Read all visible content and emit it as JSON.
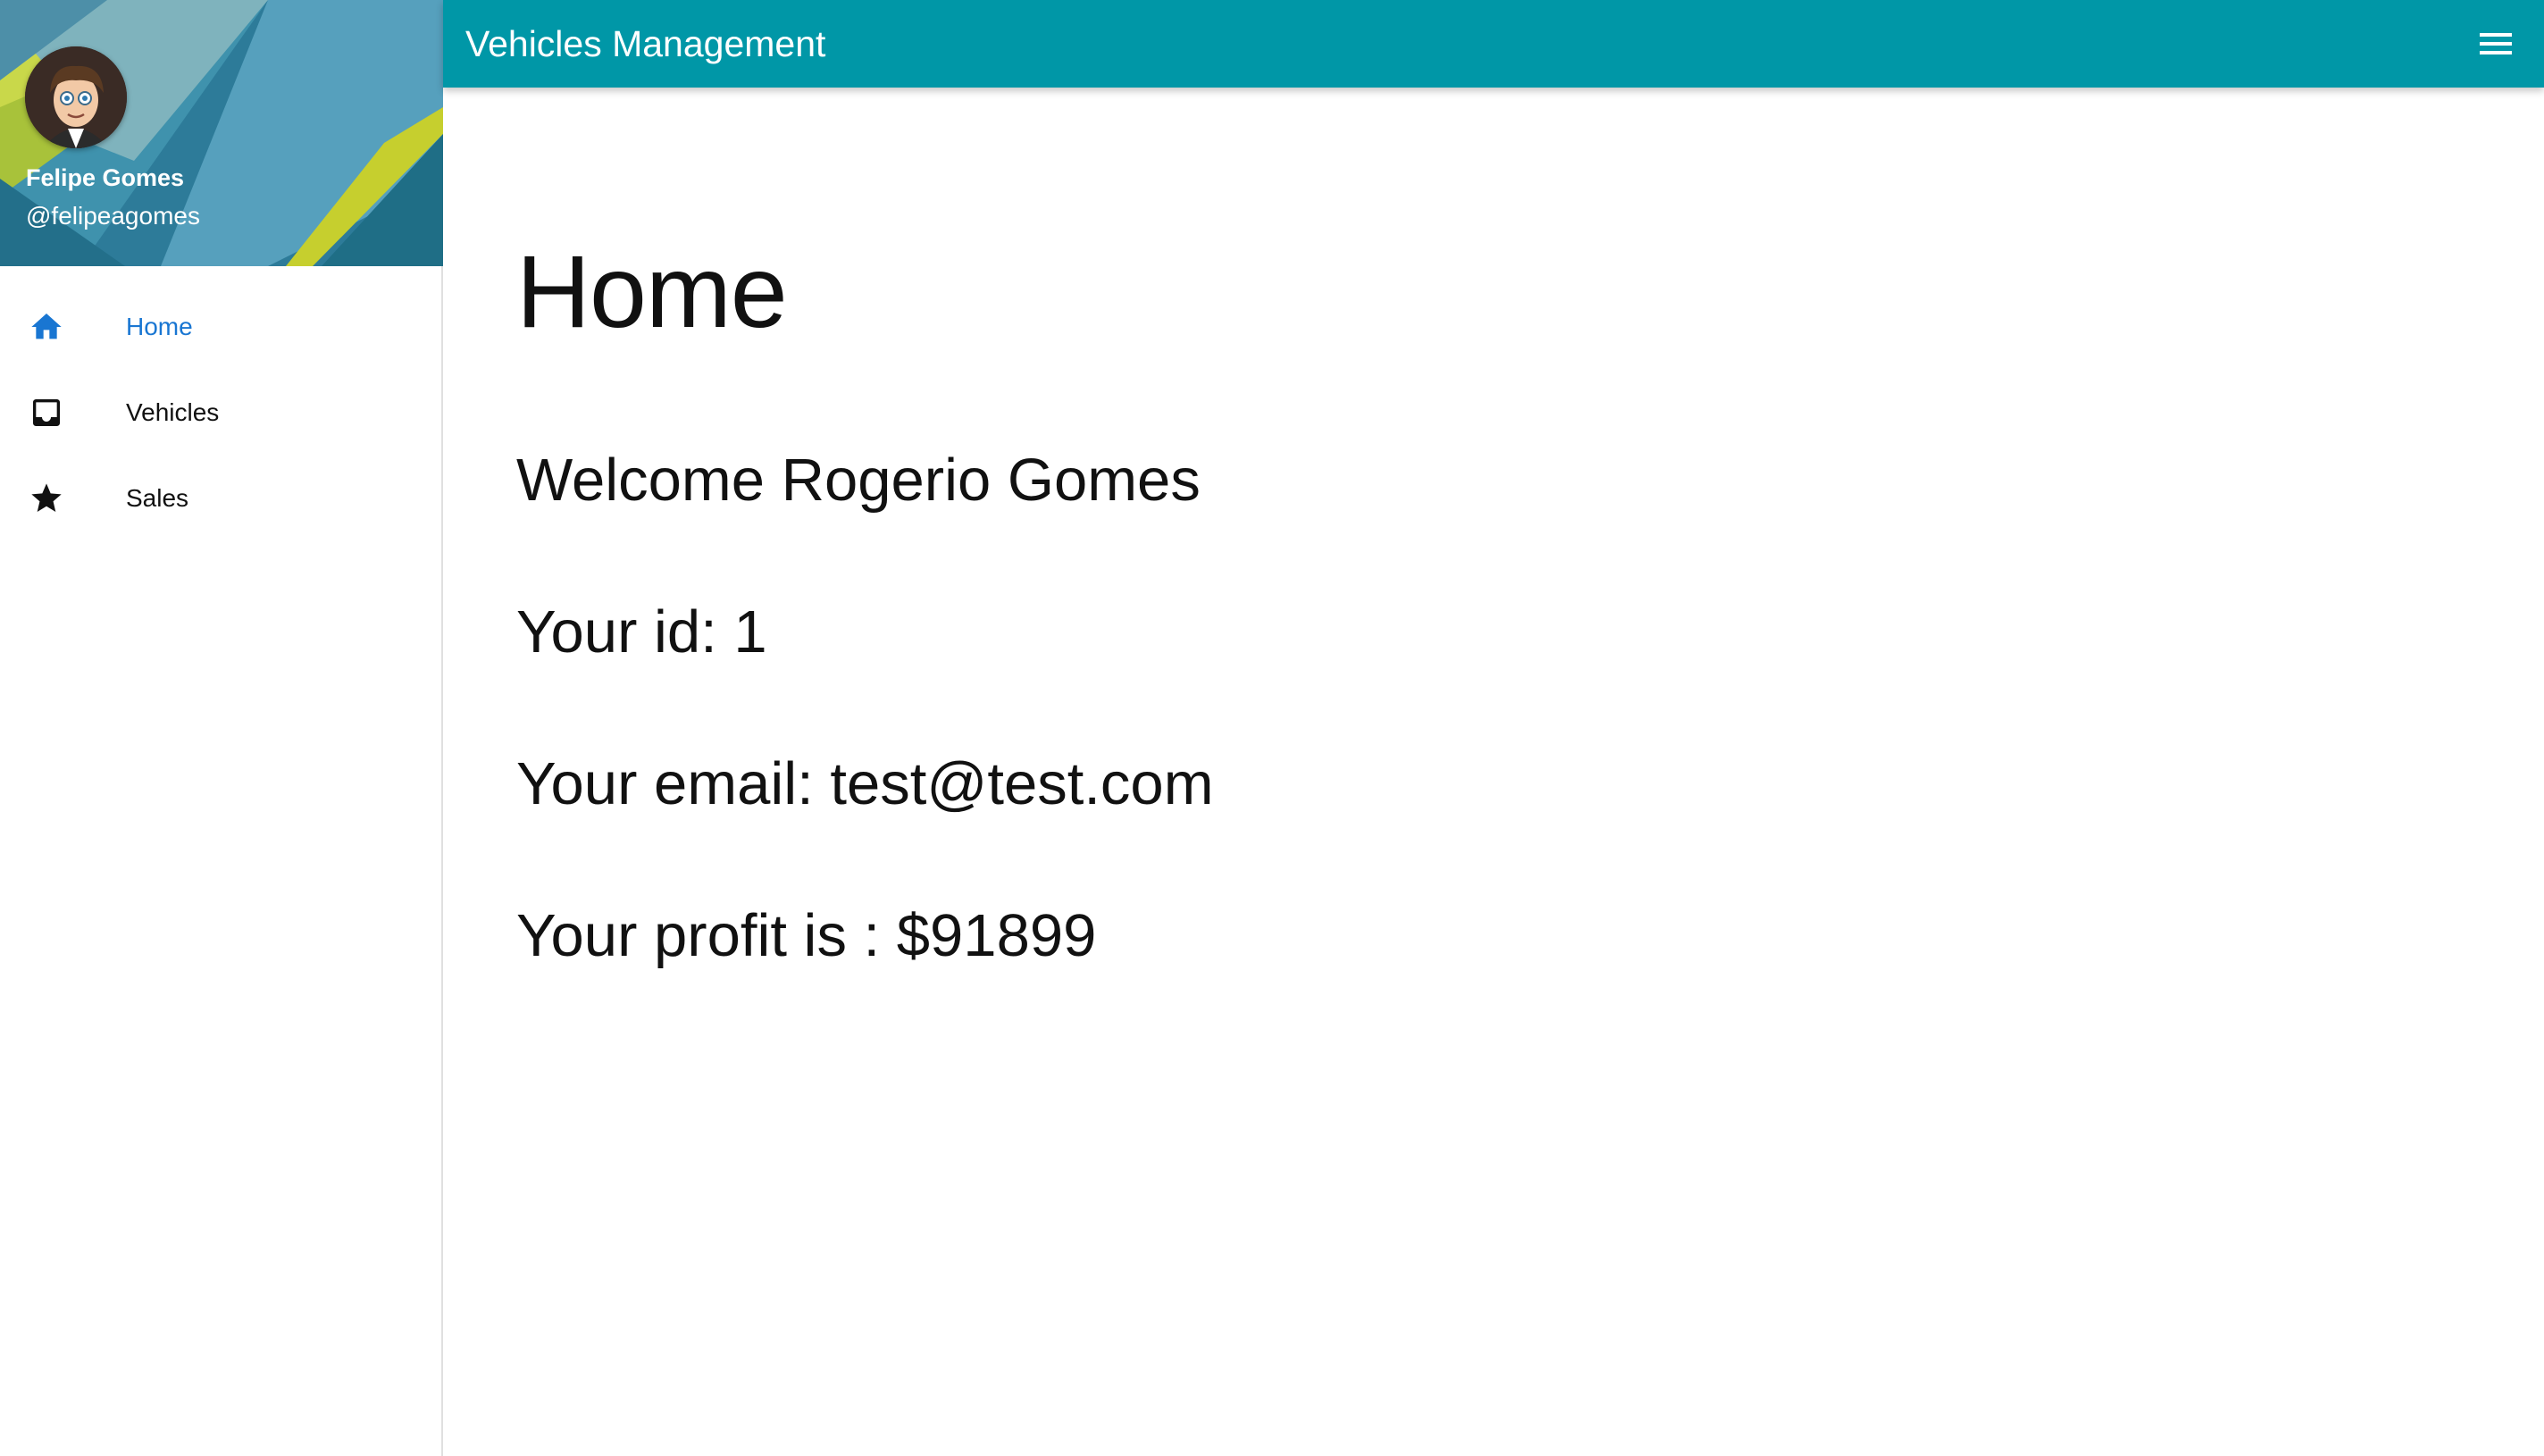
{
  "app": {
    "title": "Vehicles Management",
    "menu_icon": "hamburger-menu-icon",
    "accent_color": "#0097a7",
    "active_color": "#1976d2"
  },
  "profile": {
    "name": "Felipe Gomes",
    "handle": "@felipeagomes",
    "avatar_icon": "user-avatar"
  },
  "sidebar": {
    "items": [
      {
        "label": "Home",
        "icon": "home-icon",
        "active": true
      },
      {
        "label": "Vehicles",
        "icon": "inbox-icon",
        "active": false
      },
      {
        "label": "Sales",
        "icon": "star-icon",
        "active": false
      }
    ]
  },
  "main": {
    "title": "Home",
    "welcome": "Welcome Rogerio Gomes",
    "id_line": "Your id: 1",
    "email_line": "Your email: test@test.com",
    "profit_line": "Your profit is : $91899"
  }
}
